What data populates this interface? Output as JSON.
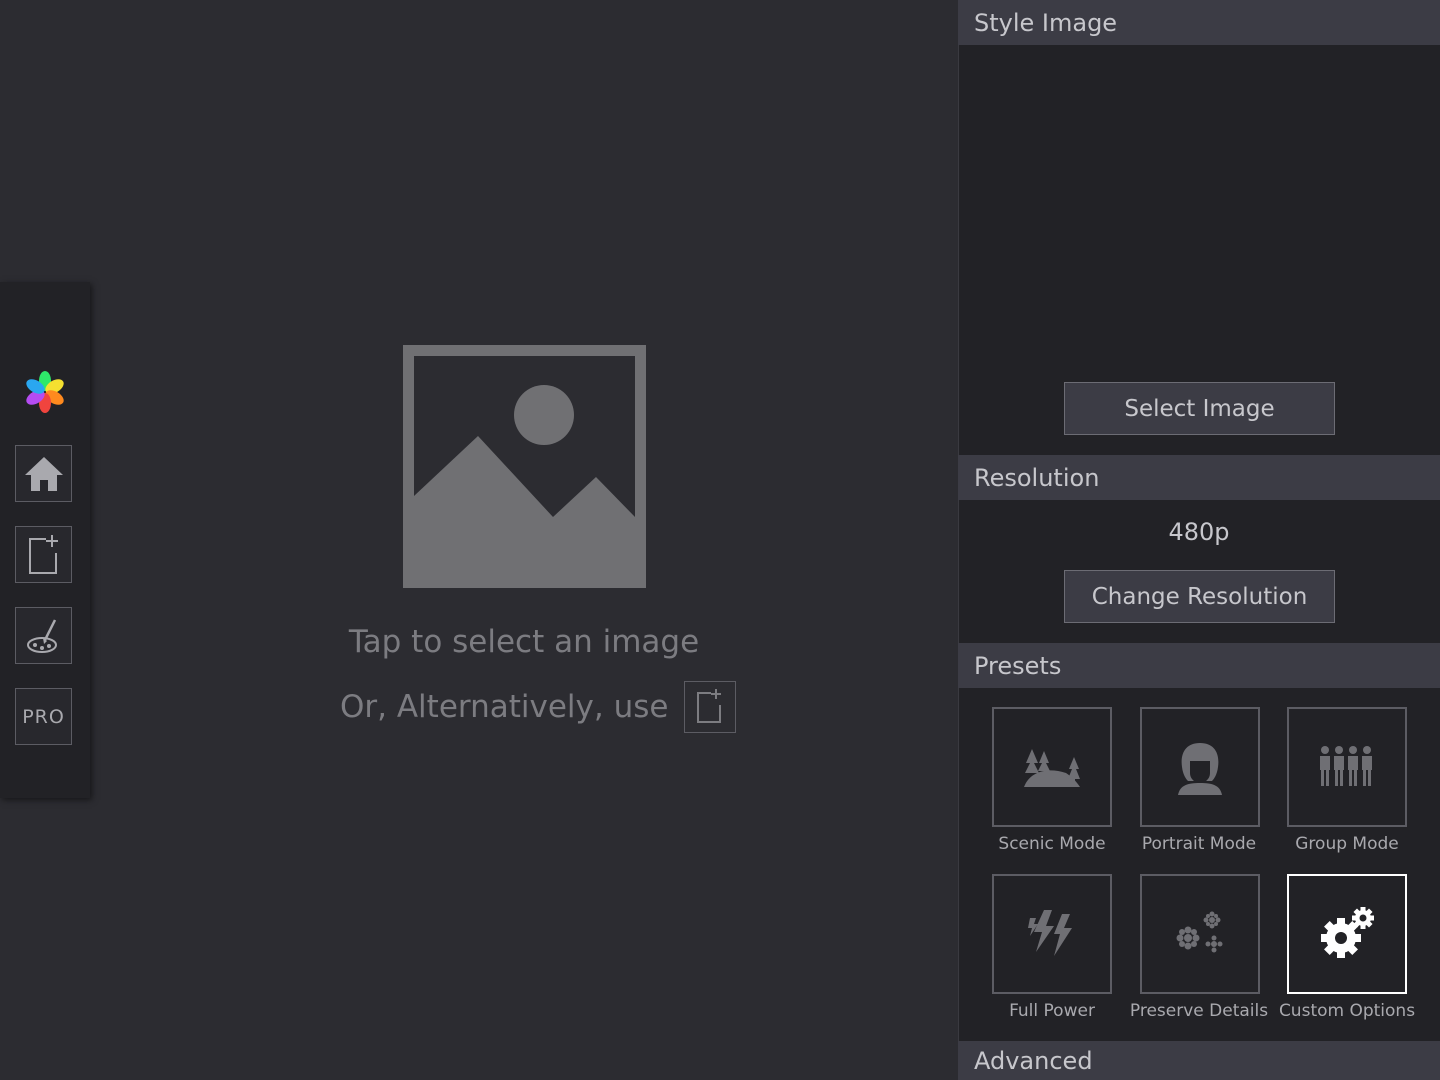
{
  "toolbar": {
    "pro_label": "PRO",
    "buttons": [
      "home-icon",
      "new-document-icon",
      "brush-palette-icon",
      "pro-badge"
    ]
  },
  "canvas": {
    "tap_text": "Tap to select an image",
    "alt_text": "Or, Alternatively, use"
  },
  "panel": {
    "style_image": {
      "header": "Style Image",
      "select_button": "Select Image"
    },
    "resolution": {
      "header": "Resolution",
      "value": "480p",
      "change_button": "Change Resolution"
    },
    "presets": {
      "header": "Presets",
      "items": [
        {
          "label": "Scenic Mode",
          "icon": "landscape-icon",
          "selected": false
        },
        {
          "label": "Portrait Mode",
          "icon": "portrait-icon",
          "selected": false
        },
        {
          "label": "Group Mode",
          "icon": "group-icon",
          "selected": false
        },
        {
          "label": "Full Power",
          "icon": "lightning-icon",
          "selected": false
        },
        {
          "label": "Preserve Details",
          "icon": "details-icon",
          "selected": false
        },
        {
          "label": "Custom Options",
          "icon": "gears-icon",
          "selected": true
        }
      ]
    },
    "advanced": {
      "header": "Advanced"
    }
  },
  "colors": {
    "background": "#2c2c31",
    "panel": "#222226",
    "header": "#3c3c45",
    "selected_border": "#ffffff",
    "status_dot": "#d18b2a"
  }
}
